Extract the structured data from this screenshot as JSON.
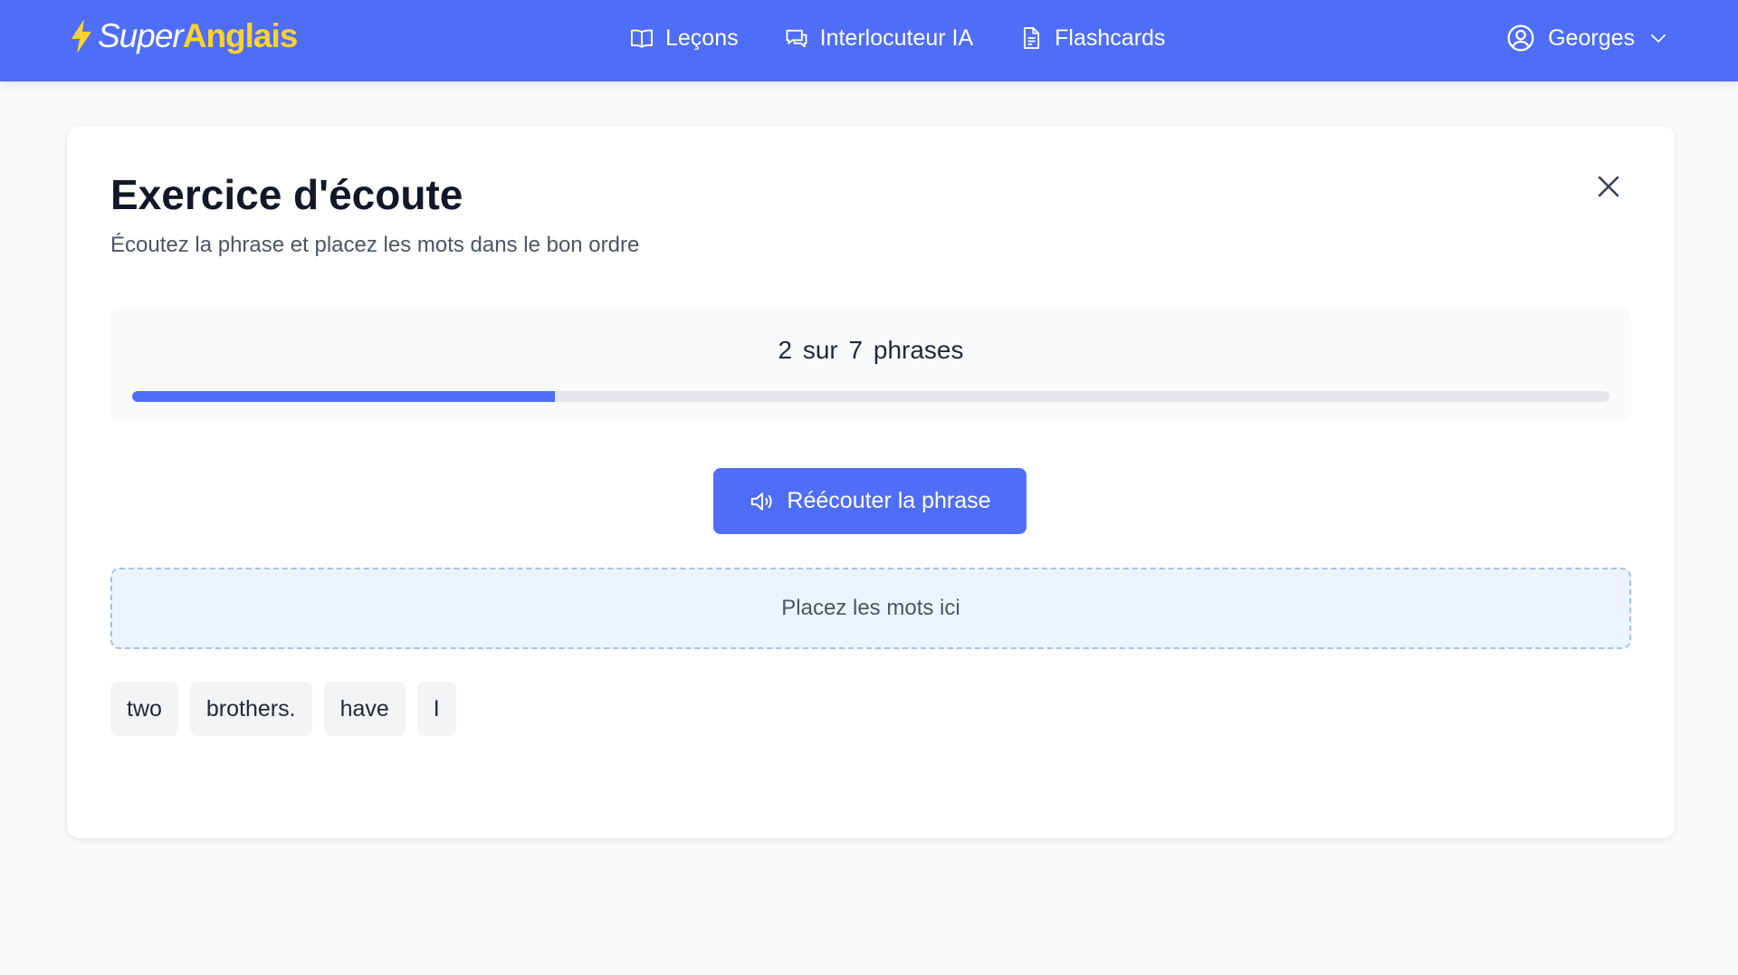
{
  "header": {
    "logo": {
      "part1": "Super",
      "part2": "Anglais"
    },
    "nav": [
      {
        "label": "Leçons",
        "icon": "book-open-icon"
      },
      {
        "label": "Interlocuteur IA",
        "icon": "chat-bubbles-icon"
      },
      {
        "label": "Flashcards",
        "icon": "document-icon"
      }
    ],
    "user": {
      "name": "Georges",
      "icon": "user-circle-icon"
    }
  },
  "exercise": {
    "title": "Exercice d'écoute",
    "subtitle": "Écoutez la phrase et placez les mots dans le bon ordre",
    "progress": {
      "current": 2,
      "total": 7,
      "text": "2 sur 7 phrases",
      "fill_percent": 28.6
    },
    "replay_label": "Réécouter la phrase",
    "drop_placeholder": "Placez les mots ici",
    "words": [
      "two",
      "brothers.",
      "have",
      "I"
    ]
  },
  "colors": {
    "brand": "#4f6ef7",
    "logo_accent": "#ffd22e",
    "background": "#f9fafb",
    "drop_zone_bg": "#eef4ff",
    "drop_zone_border": "#a9bff0"
  }
}
